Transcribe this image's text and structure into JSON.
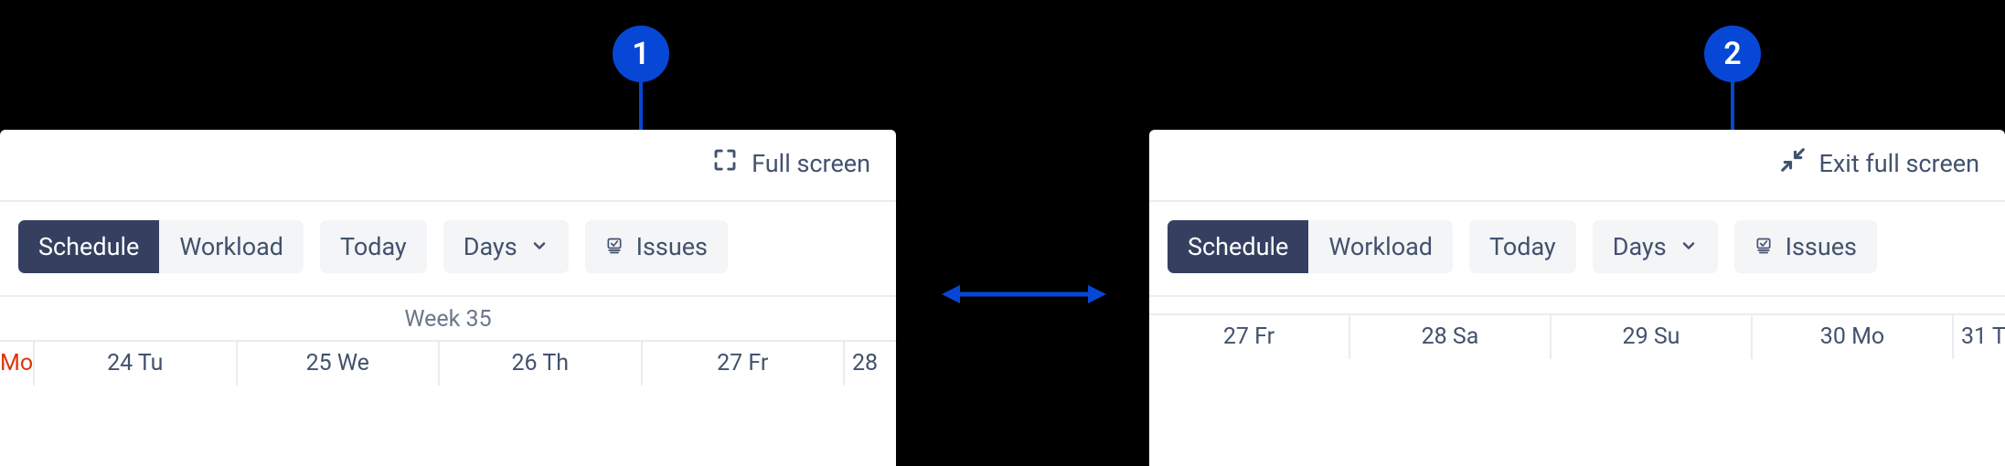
{
  "callouts": {
    "one": "1",
    "two": "2"
  },
  "fullscreen": {
    "enter_label": "Full screen",
    "exit_label": "Exit full screen"
  },
  "toolbar": {
    "tabs": {
      "schedule": "Schedule",
      "workload": "Workload"
    },
    "today": "Today",
    "days": "Days",
    "issues": "Issues"
  },
  "timeline_left": {
    "week_label": "Week 35",
    "days": [
      {
        "label": "Mo",
        "today": true,
        "partial": "left"
      },
      {
        "label": "24 Tu"
      },
      {
        "label": "25 We"
      },
      {
        "label": "26 Th"
      },
      {
        "label": "27 Fr"
      },
      {
        "label": "28",
        "partial": "right"
      }
    ]
  },
  "timeline_right": {
    "week_label": "",
    "days": [
      {
        "label": "27 Fr"
      },
      {
        "label": "28 Sa"
      },
      {
        "label": "29 Su"
      },
      {
        "label": "30 Mo"
      },
      {
        "label": "31 T",
        "partial": "right"
      }
    ]
  }
}
